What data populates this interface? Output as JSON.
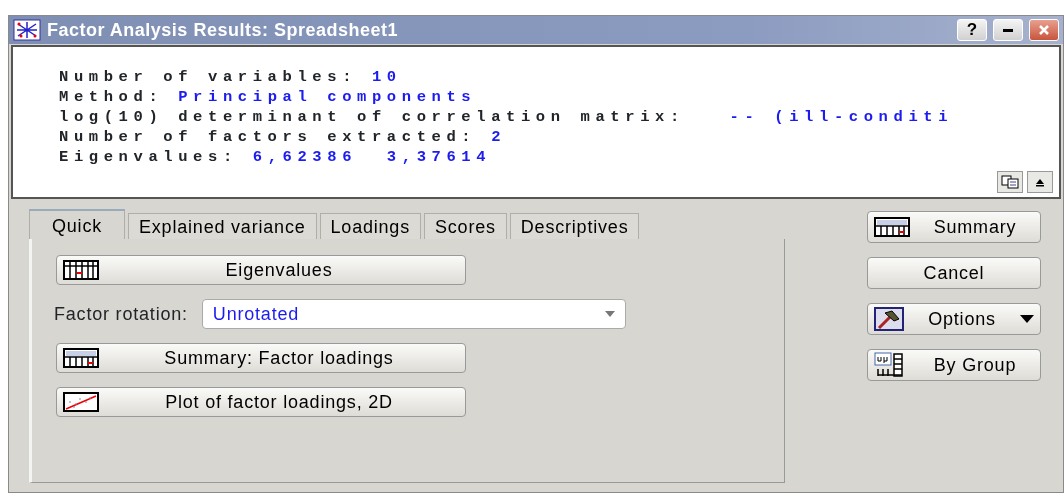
{
  "window": {
    "title": "Factor Analysis Results: Spreadsheet1",
    "controls": [
      {
        "kind": "help",
        "label": "?"
      },
      {
        "kind": "minimize"
      },
      {
        "kind": "close"
      }
    ]
  },
  "output": {
    "lines": [
      {
        "label": "Number of variables:",
        "value": "10"
      },
      {
        "label": "Method:",
        "value": "Principal components"
      },
      {
        "label": "log(10) determinant of correlation matrix:",
        "value": "  -- (ill-conditi"
      },
      {
        "label": "Number of factors extracted:",
        "value": "2"
      },
      {
        "label": "Eigenvalues:",
        "value": "6,62386  3,37614"
      }
    ]
  },
  "tabs": [
    {
      "label": "Quick",
      "selected": true
    },
    {
      "label": "Explained variance",
      "selected": false
    },
    {
      "label": "Loadings",
      "selected": false
    },
    {
      "label": "Scores",
      "selected": false
    },
    {
      "label": "Descriptives",
      "selected": false
    }
  ],
  "quick": {
    "items": [
      {
        "kind": "button",
        "label": "Eigenvalues"
      },
      {
        "kind": "select",
        "label": "Factor rotation:",
        "value": "Unrotated"
      },
      {
        "kind": "button",
        "label": "Summary: Factor loadings"
      },
      {
        "kind": "button",
        "label": "Plot of factor loadings, 2D"
      }
    ]
  },
  "side_buttons": [
    {
      "label": "Summary"
    },
    {
      "label": "Cancel"
    },
    {
      "label": "Options"
    },
    {
      "label": "By Group"
    }
  ]
}
